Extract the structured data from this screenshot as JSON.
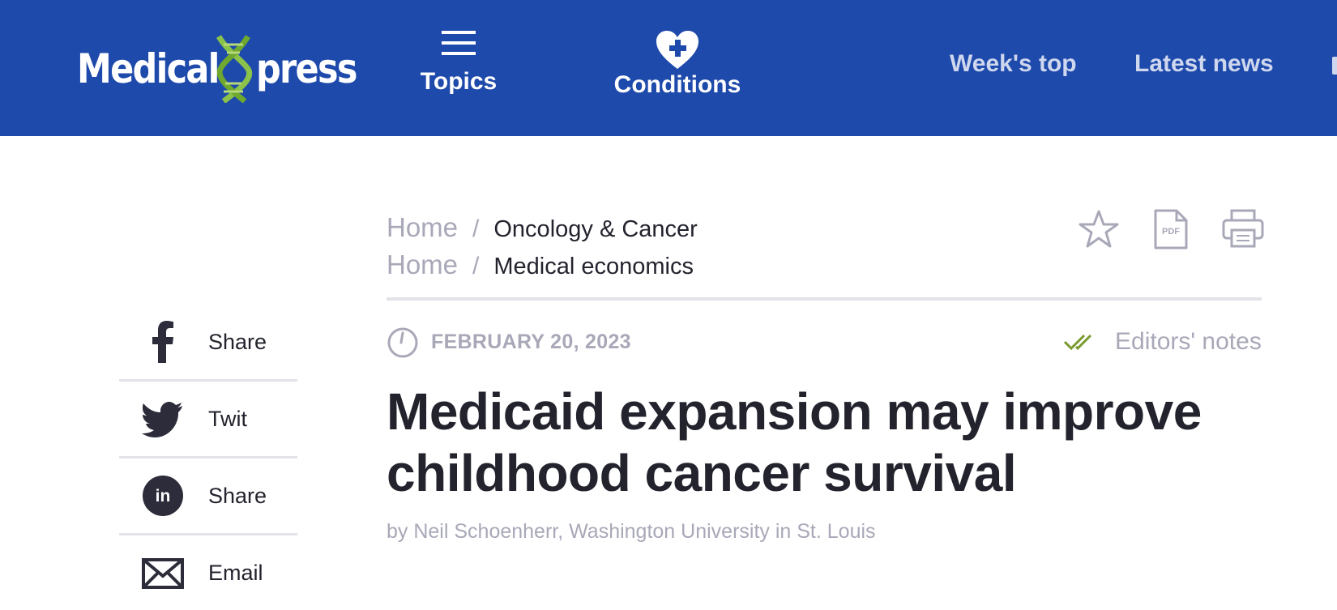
{
  "header": {
    "logo": {
      "left": "Medical",
      "right": "press"
    },
    "nav": [
      {
        "label": "Topics",
        "icon": "menu-icon"
      },
      {
        "label": "Conditions",
        "icon": "heart-plus-icon"
      }
    ],
    "right_links": [
      "Week's top",
      "Latest news"
    ]
  },
  "breadcrumbs": [
    {
      "home": "Home",
      "separator": "/",
      "category": "Oncology & Cancer"
    },
    {
      "home": "Home",
      "separator": "/",
      "category": "Medical economics"
    }
  ],
  "tools": [
    "star-icon",
    "pdf-icon",
    "printer-icon"
  ],
  "article": {
    "date": "FEBRUARY 20, 2023",
    "editors_notes": "Editors' notes",
    "title": "Medicaid expansion may improve childhood cancer survival",
    "byline": "by Neil Schoenherr, Washington University in St. Louis"
  },
  "share": [
    {
      "label": "Share",
      "icon": "facebook-icon"
    },
    {
      "label": "Twit",
      "icon": "twitter-icon"
    },
    {
      "label": "Share",
      "icon": "linkedin-icon"
    },
    {
      "label": "Email",
      "icon": "email-icon"
    }
  ],
  "colors": {
    "header_bg": "#1e4aab",
    "logo_dna": "#8bc34a",
    "text_dark": "#23232e",
    "text_muted": "#a8a8b8",
    "check_green": "#7a9a2e"
  }
}
